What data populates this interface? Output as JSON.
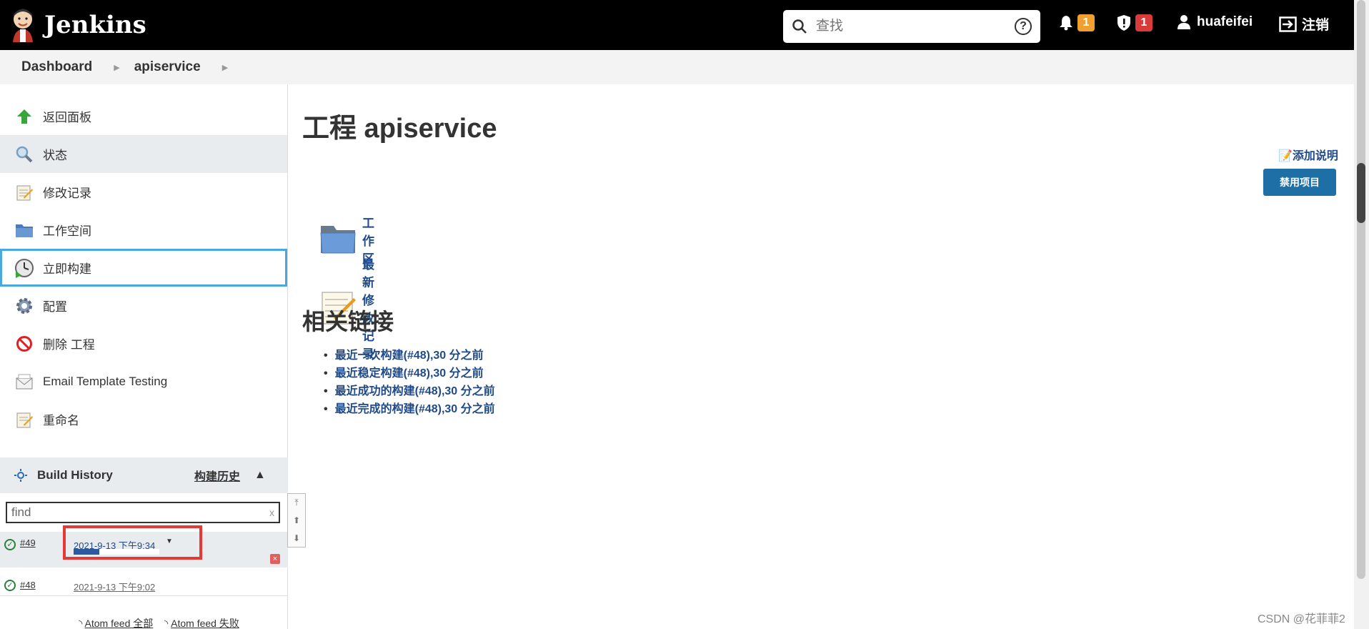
{
  "header": {
    "brand": "Jenkins",
    "search_placeholder": "查找",
    "help": "?",
    "notifications_count": "1",
    "security_count": "1",
    "user": "huafeifei",
    "logout": "注销"
  },
  "breadcrumb": [
    "Dashboard",
    "apiservice"
  ],
  "sidebar": {
    "tasks": [
      {
        "label": "返回面板",
        "icon": "up-arrow-icon"
      },
      {
        "label": "状态",
        "icon": "search-icon"
      },
      {
        "label": "修改记录",
        "icon": "notepad-icon"
      },
      {
        "label": "工作空间",
        "icon": "folder-icon"
      },
      {
        "label": "立即构建",
        "icon": "clock-icon"
      },
      {
        "label": "配置",
        "icon": "gear-icon"
      },
      {
        "label": "删除 工程",
        "icon": "no-icon"
      },
      {
        "label": "Email Template Testing",
        "icon": "envelope-icon"
      },
      {
        "label": "重命名",
        "icon": "notepad-icon"
      }
    ],
    "build_history": {
      "title": "Build History",
      "title_zh": "构建历史",
      "filter_placeholder": "find",
      "clear": "x",
      "builds": [
        {
          "number": "#49",
          "date": "2021-9-13 下午9:34",
          "progress": 0.3
        },
        {
          "number": "#48",
          "date": "2021-9-13 下午9:02"
        }
      ],
      "atom_all": "Atom feed 全部",
      "atom_fail": "Atom feed 失败"
    }
  },
  "main": {
    "title": "工程 apiservice",
    "add_description": "添加说明",
    "disable_button": "禁用项目",
    "links": [
      {
        "label": "工作区",
        "icon": "folder-icon"
      },
      {
        "label": "最新修改记录",
        "icon": "notepad-icon"
      }
    ],
    "permalinks_heading": "相关链接",
    "permalinks": [
      "最近一次构建(#48),30 分之前",
      "最近稳定构建(#48),30 分之前",
      "最近成功的构建(#48),30 分之前",
      "最近完成的构建(#48),30 分之前"
    ]
  },
  "watermark": "CSDN @花菲菲2"
}
